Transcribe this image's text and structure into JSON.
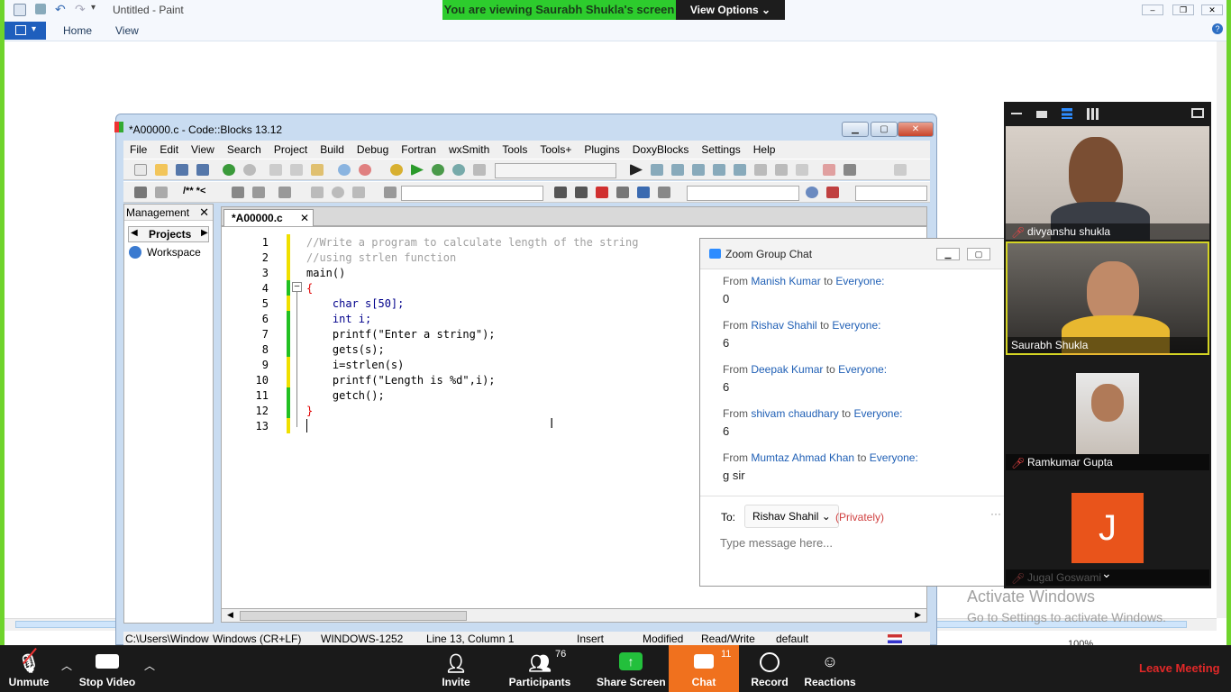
{
  "paint": {
    "title": "Untitled - Paint",
    "tabs": [
      "Home",
      "View"
    ],
    "zoom": "100%"
  },
  "zoom_banner": {
    "message": "You are viewing Saurabh Shukla's screen",
    "options": "View Options"
  },
  "codeblocks": {
    "title": "*A00000.c - Code::Blocks 13.12",
    "menu": [
      "File",
      "Edit",
      "View",
      "Search",
      "Project",
      "Build",
      "Debug",
      "Fortran",
      "wxSmith",
      "Tools",
      "Tools+",
      "Plugins",
      "DoxyBlocks",
      "Settings",
      "Help"
    ],
    "management": {
      "title": "Management",
      "tab": "Projects",
      "item": "Workspace"
    },
    "editor_tab": "*A00000.c",
    "code_lines": [
      "//Write a program to calculate length of the string",
      "//using strlen function",
      "main()",
      "{",
      "    char s[50];",
      "    int i;",
      "    printf(\"Enter a string\");",
      "    gets(s);",
      "    i=strlen(s)",
      "    printf(\"Length is %d\",i);",
      "    getch();",
      "}",
      ""
    ],
    "line_numbers": [
      "1",
      "2",
      "3",
      "4",
      "5",
      "6",
      "7",
      "8",
      "9",
      "10",
      "11",
      "12",
      "13"
    ],
    "status": {
      "path": "C:\\Users\\Window",
      "eol": "Windows (CR+LF)",
      "encoding": "WINDOWS-1252",
      "position": "Line 13, Column 1",
      "mode": "Insert",
      "modified": "Modified",
      "access": "Read/Write",
      "lang": "default"
    }
  },
  "chat": {
    "title": "Zoom Group Chat",
    "from_label": "From",
    "to_label": "to",
    "messages": [
      {
        "from": "Manish Kumar",
        "to": "Everyone:",
        "text": "0"
      },
      {
        "from": "Rishav Shahil",
        "to": "Everyone:",
        "text": "6"
      },
      {
        "from": "Deepak Kumar",
        "to": "Everyone:",
        "text": "6"
      },
      {
        "from": "shivam chaudhary",
        "to": "Everyone:",
        "text": "6"
      },
      {
        "from": "Mumtaz Ahmad Khan",
        "to": "Everyone:",
        "text": "g sir"
      }
    ],
    "to_prefix": "To:",
    "recipient": "Rishav Shahil",
    "privacy": "(Privately)",
    "placeholder": "Type message here..."
  },
  "gallery": {
    "participants": [
      {
        "name": "divyanshu shukla",
        "muted": true
      },
      {
        "name": "Saurabh Shukla",
        "muted": false
      },
      {
        "name": "Ramkumar Gupta",
        "muted": true
      },
      {
        "name": "Jugal Goswami",
        "initial": "J",
        "muted": true
      }
    ]
  },
  "watermark": {
    "line1": "Activate Windows",
    "line2": "Go to Settings to activate Windows."
  },
  "zoom_toolbar": {
    "unmute": "Unmute",
    "stop_video": "Stop Video",
    "invite": "Invite",
    "participants": "Participants",
    "participants_count": "76",
    "share_screen": "Share Screen",
    "chat": "Chat",
    "chat_count": "11",
    "record": "Record",
    "reactions": "Reactions",
    "leave": "Leave Meeting"
  },
  "colors": {
    "zoom_green": "#2dcc2d",
    "chat_orange": "#f0711e",
    "leave_red": "#e02828",
    "avatar_orange": "#e9541b"
  }
}
